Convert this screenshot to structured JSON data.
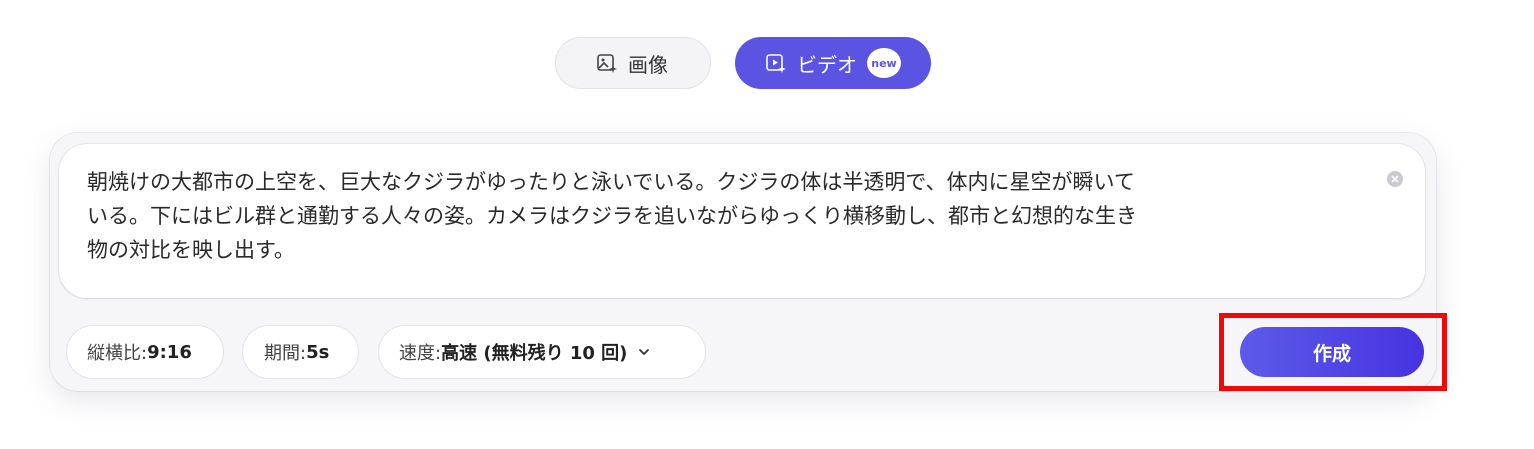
{
  "tabs": {
    "image_label": "画像",
    "video_label": "ビデオ",
    "new_badge": "new"
  },
  "prompt": {
    "text": "朝焼けの大都市の上空を、巨大なクジラがゆったりと泳いでいる。クジラの体は半透明で、体内に星空が瞬いて\nいる。下にはビル群と通勤する人々の姿。カメラはクジラを追いながらゆっくり横移動し、都市と幻想的な生き\n物の対比を映し出す。"
  },
  "options": {
    "ratio_label": "縦横比:",
    "ratio_value": "9:16",
    "duration_label": "期間:",
    "duration_value": "5s",
    "speed_label": "速度:",
    "speed_value": "高速 (無料残り 10 回)"
  },
  "create_button": "作成",
  "colors": {
    "accent": "#5b54e3",
    "highlight": "#ee0a0a"
  },
  "icons": {
    "image_tab": "image-sparkle-icon",
    "video_tab": "video-sparkle-icon",
    "clear": "close-circle-icon",
    "dropdown": "chevron-down-icon"
  }
}
